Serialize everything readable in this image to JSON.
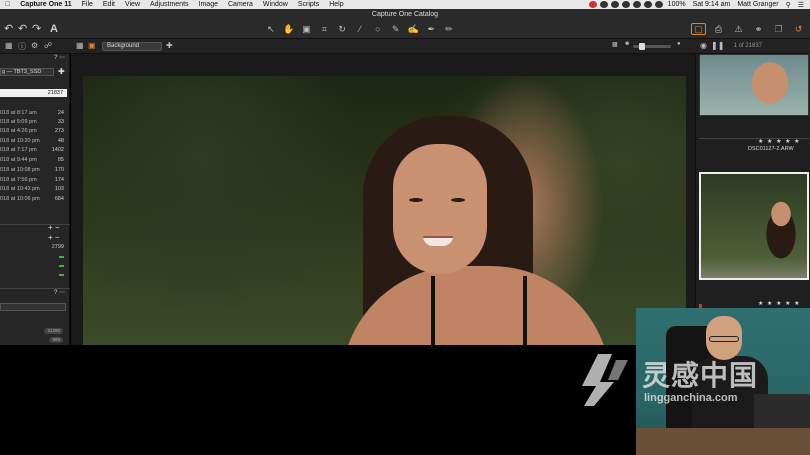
{
  "menubar": {
    "app_name": "Capture One 11",
    "items": [
      "File",
      "Edit",
      "View",
      "Adjustments",
      "Image",
      "Camera",
      "Window",
      "Scripts",
      "Help"
    ],
    "battery": "100%",
    "clock": "Sat 9:14 am",
    "user": "Matt Granger"
  },
  "toolbar": {
    "window_title": "Capture One Catalog",
    "text_tool_glyph": "A",
    "tools": [
      "pointer-icon",
      "pan-icon",
      "loupe-icon",
      "crop-icon",
      "rotate-icon",
      "keystone-icon",
      "spot-icon",
      "brush-icon",
      "erase-icon",
      "picker-icon",
      "annotate-icon"
    ]
  },
  "subbar": {
    "variant_label": "Background",
    "image_count": "1 of 21837"
  },
  "left_panel": {
    "collection_select": "g — TBT3_SSD",
    "total_count": "21837",
    "imports": [
      {
        "label": "018 at 8:17 am",
        "count": "24"
      },
      {
        "label": "018 at 5:09 pm",
        "count": "33"
      },
      {
        "label": "018 at 4:26 pm",
        "count": "273"
      },
      {
        "label": "018 at 10:20 pm",
        "count": "48"
      },
      {
        "label": "018 at 7:17 pm",
        "count": "1402"
      },
      {
        "label": "018 at 9:44 pm",
        "count": "85"
      },
      {
        "label": "018 at 10:08 pm",
        "count": "170"
      },
      {
        "label": "018 at 7:56 pm",
        "count": "174"
      },
      {
        "label": "018 at 10:43 pm",
        "count": "103"
      },
      {
        "label": "018 at 10:06 pm",
        "count": "684"
      }
    ],
    "album_count": "2799",
    "pill_a": "21290",
    "pill_b": "568"
  },
  "browser": {
    "first_thumb_name": "DSC01127-2.ARW",
    "stars": "★ ★ ★ ★ ★"
  },
  "watermark": {
    "brand_cn": "灵感中国",
    "url": "lingganchina.com"
  }
}
